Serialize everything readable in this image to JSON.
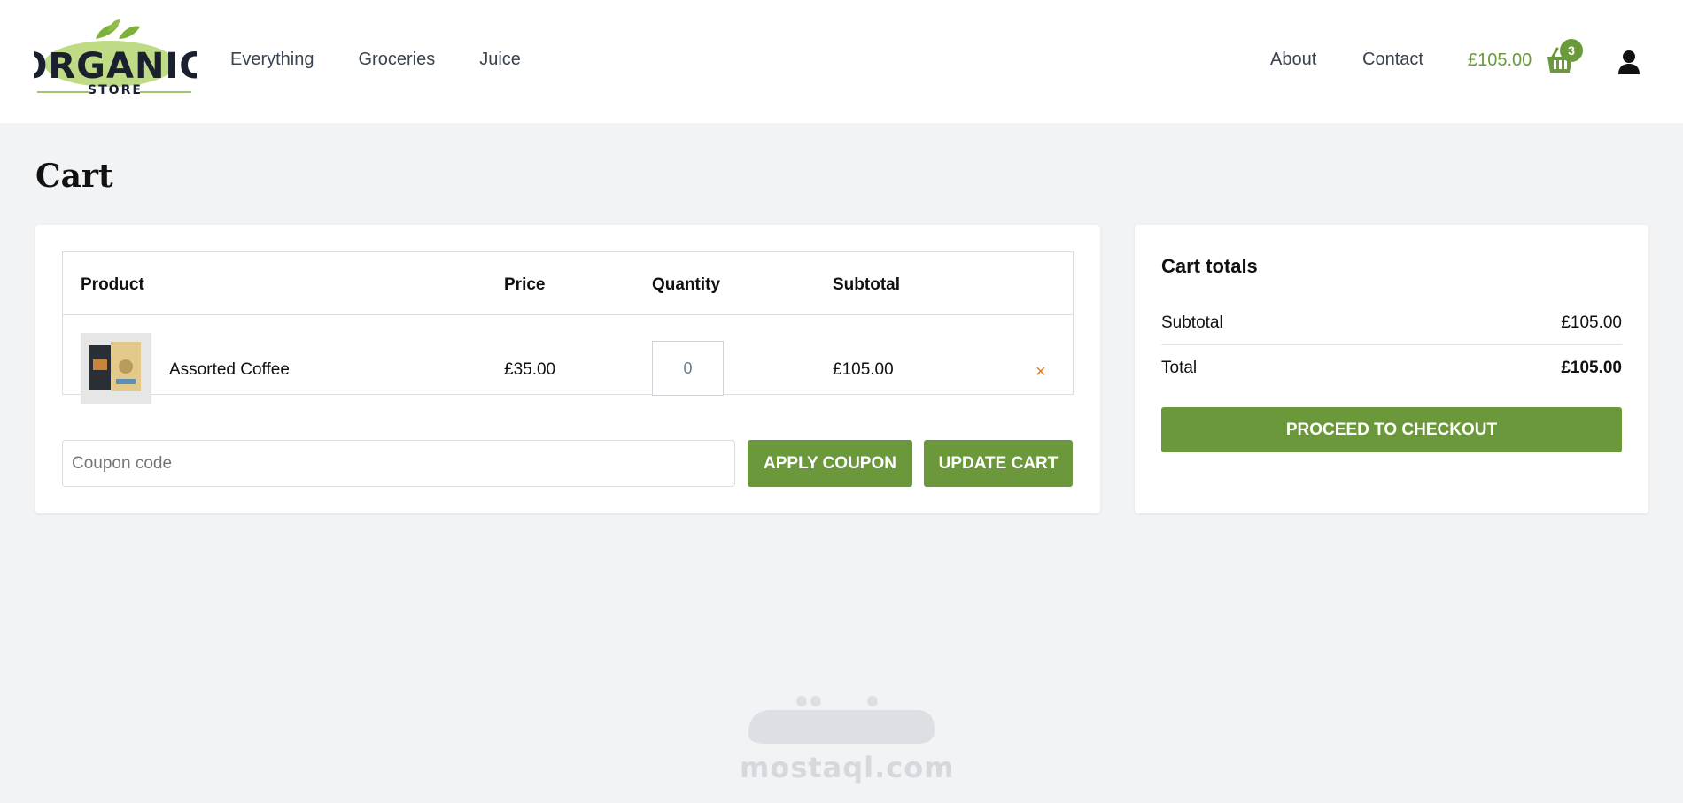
{
  "header": {
    "logo_text": "ORGANIC",
    "logo_subtext": "STORE",
    "nav_left": [
      "Everything",
      "Groceries",
      "Juice"
    ],
    "nav_about": "About",
    "nav_contact": "Contact",
    "cart_amount": "£105.00",
    "cart_count": "3"
  },
  "page": {
    "title": "Cart"
  },
  "cart": {
    "headers": {
      "product": "Product",
      "price": "Price",
      "quantity": "Quantity",
      "subtotal": "Subtotal"
    },
    "items": [
      {
        "name": "Assorted Coffee",
        "price": "£35.00",
        "quantity": "0",
        "subtotal": "£105.00",
        "remove": "×"
      }
    ],
    "coupon_placeholder": "Coupon code",
    "apply_label": "APPLY COUPON",
    "update_label": "UPDATE CART"
  },
  "totals": {
    "title": "Cart totals",
    "subtotal_label": "Subtotal",
    "subtotal_value": "£105.00",
    "total_label": "Total",
    "total_value": "£105.00",
    "checkout_label": "PROCEED TO CHECKOUT"
  },
  "watermark": {
    "text": "mostaql.com"
  },
  "colors": {
    "accent": "#6a983a",
    "remove": "#e07a1f",
    "background": "#f2f3f5"
  }
}
